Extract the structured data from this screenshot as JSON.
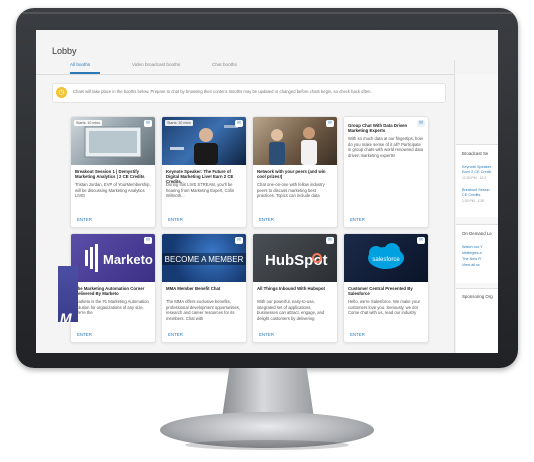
{
  "page": {
    "title": "Lobby"
  },
  "tabs": [
    {
      "label": "All booths",
      "active": true
    },
    {
      "label": "Video broadcast booths",
      "active": false
    },
    {
      "label": "Chat booths",
      "active": false
    }
  ],
  "notice": {
    "text": "Chats will take place in the booths below. Prepare to chat by browsing their content. Booths may be updated or changed before chats begin, so check back often.",
    "icon": "clock-icon",
    "color": "#f2c230"
  },
  "cards": [
    {
      "badge": "Starts: 10 mins",
      "title": "Breakout Session 1 | Demystify Marketing Analytics | 2 CE Credits",
      "desc": "Tristan Jordan, EVP of YourMembership, will be discussing Marketing Analytics LIVE!",
      "enter": "ENTER"
    },
    {
      "badge": "Starts: 30 mins",
      "title": "Keynote Speaker: The Future of Digital Marketing Live! Earn 2 CE Credits.",
      "desc": "During this LIVE STREAM, you'll be hearing from Marketing Expert, Colin Wilmoth...",
      "enter": "ENTER"
    },
    {
      "title": "Network with your peers (and win cool prizes!)",
      "desc": "Chat one-on-one with fellow industry peers to discuss marketing best practices. Topics can include data",
      "enter": "ENTER"
    },
    {
      "title": "Group Chat With Data Driven Marketing Experts",
      "desc": "With so much data at our fingertips, how do you make sense of it all? Participate in group chats with world renowned data driven marketing experts!",
      "enter": "ENTER"
    },
    {
      "logo": "Marketo",
      "title": "The Marketing Automation Corner Delivered By Marketo",
      "desc": "Marketo is the #1 Marketing Automation solution for organizations of any size. We're the",
      "enter": "ENTER"
    },
    {
      "logo": "BECOME A MEMBER",
      "title": "MMA Member Benefit Chat",
      "desc": "The MMA offers exclusive benefits, professional development opportunities, research and career resources for its members. Chat with",
      "enter": "ENTER"
    },
    {
      "logo": "HubSpot",
      "title": "All Things Inbound With Hubspot",
      "desc": "With our powerful, easy-to-use, integrated set of applications, businesses can attract, engage, and delight customers by delivering",
      "enter": "ENTER"
    },
    {
      "logo": "salesforce",
      "title": "Customer Central Presented By Salesforce",
      "desc": "Hello, we're Salesforce. We make your customers love you. Seriously, we do! Come chat with us, read our industry",
      "enter": "ENTER"
    }
  ],
  "sidebar": {
    "broadcast_heading": "Broadcast Se",
    "items": [
      {
        "link": "Keynote Speaker",
        "link2": "Earn 2 CE Credit",
        "time": "12:00 PM - 12:3"
      },
      {
        "link": "Breakout Sessio",
        "link2": "CE Credits",
        "time": "1:00 PM - 1:30"
      }
    ],
    "ondemand_heading": "On Demand Le",
    "ondemand_items": [
      "Watch our Y",
      "strategies a",
      "The New R",
      "View all sc"
    ],
    "sponsor_heading": "Sponsoring Org",
    "sponsor_letter": "M"
  }
}
